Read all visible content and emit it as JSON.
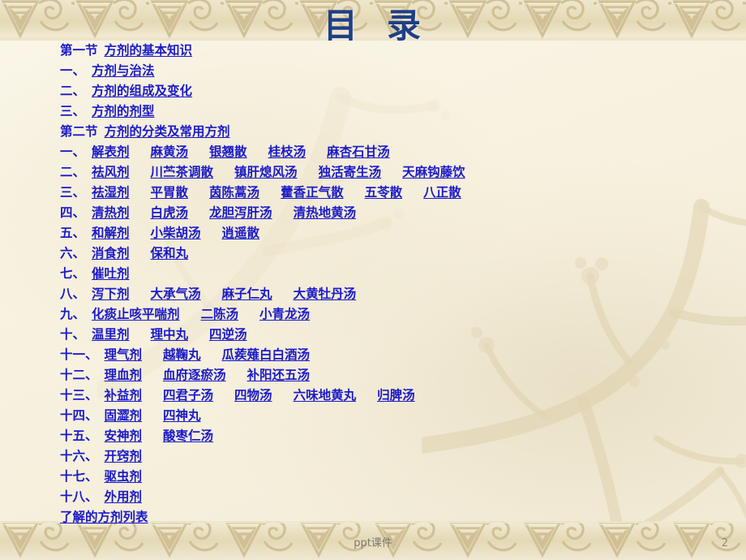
{
  "slide": {
    "title_part1": "目",
    "title_part2": "录",
    "footer_note": "ppt课件",
    "page_number": "2",
    "link_color": "#1a1ac8",
    "title_color": "#1f3f86",
    "background_color": "#f7f2e0",
    "border_color": "#d8cba4"
  },
  "toc": {
    "rows": [
      {
        "num": "第一节",
        "link": "方剂的基本知识",
        "items": []
      },
      {
        "num": "一、",
        "link": "方剂与治法",
        "items": []
      },
      {
        "num": "二、",
        "link": "方剂的组成及变化",
        "items": []
      },
      {
        "num": "三、",
        "link": "方剂的剂型",
        "items": []
      },
      {
        "num": "第二节",
        "link": "方剂的分类及常用方剂",
        "items": []
      },
      {
        "num": "一、",
        "link": "解表剂",
        "items": [
          "麻黄汤",
          "银翘散",
          "桂枝汤",
          "麻杏石甘汤"
        ]
      },
      {
        "num": "二、",
        "link": "祛风剂",
        "items": [
          "川苎茶调散",
          "镇肝熄风汤",
          "独活寄生汤",
          "天麻钩藤饮"
        ]
      },
      {
        "num": "三、",
        "link": "祛湿剂",
        "items": [
          "平胃散",
          "茵陈蒿汤",
          "藿香正气散",
          "五苓散",
          "八正散"
        ]
      },
      {
        "num": "四、",
        "link": "清热剂",
        "items": [
          "白虎汤",
          "龙胆泻肝汤",
          "清热地黄汤"
        ]
      },
      {
        "num": "五、",
        "link": "和解剂",
        "items": [
          "小柴胡汤",
          "逍遥散"
        ]
      },
      {
        "num": "六、",
        "link": "消食剂",
        "items": [
          "保和丸"
        ]
      },
      {
        "num": "七、",
        "link": "催吐剂",
        "items": []
      },
      {
        "num": "八、",
        "link": "泻下剂",
        "items": [
          "大承气汤",
          "麻子仁丸",
          "大黄牡丹汤"
        ]
      },
      {
        "num": "九、",
        "link": "化痰止咳平喘剂",
        "items": [
          "二陈汤",
          "小青龙汤"
        ]
      },
      {
        "num": "十、",
        "link": "温里剂",
        "items": [
          "理中丸",
          "四逆汤"
        ]
      },
      {
        "num": "十一、",
        "link": "理气剂",
        "items": [
          "越鞠丸",
          "瓜蒺薙白白酒汤"
        ]
      },
      {
        "num": "十二、",
        "link": "理血剂",
        "items": [
          "血府逐瘀汤",
          "补阳还五汤"
        ]
      },
      {
        "num": "十三、",
        "link": "补益剂",
        "items": [
          "四君子汤",
          "四物汤",
          "六味地黄丸",
          "归脾汤"
        ]
      },
      {
        "num": "十四、",
        "link": "固澀剂",
        "items": [
          "四神丸"
        ]
      },
      {
        "num": "十五、",
        "link": "安神剂",
        "items": [
          "酸枣仁汤"
        ]
      },
      {
        "num": "十六、",
        "link": "开窍剂",
        "items": []
      },
      {
        "num": "十七、",
        "link": "驱虫剂",
        "items": []
      },
      {
        "num": "十八、",
        "link": "外用剂",
        "items": []
      },
      {
        "num": "",
        "link": "了解的方剂列表",
        "items": []
      }
    ]
  }
}
